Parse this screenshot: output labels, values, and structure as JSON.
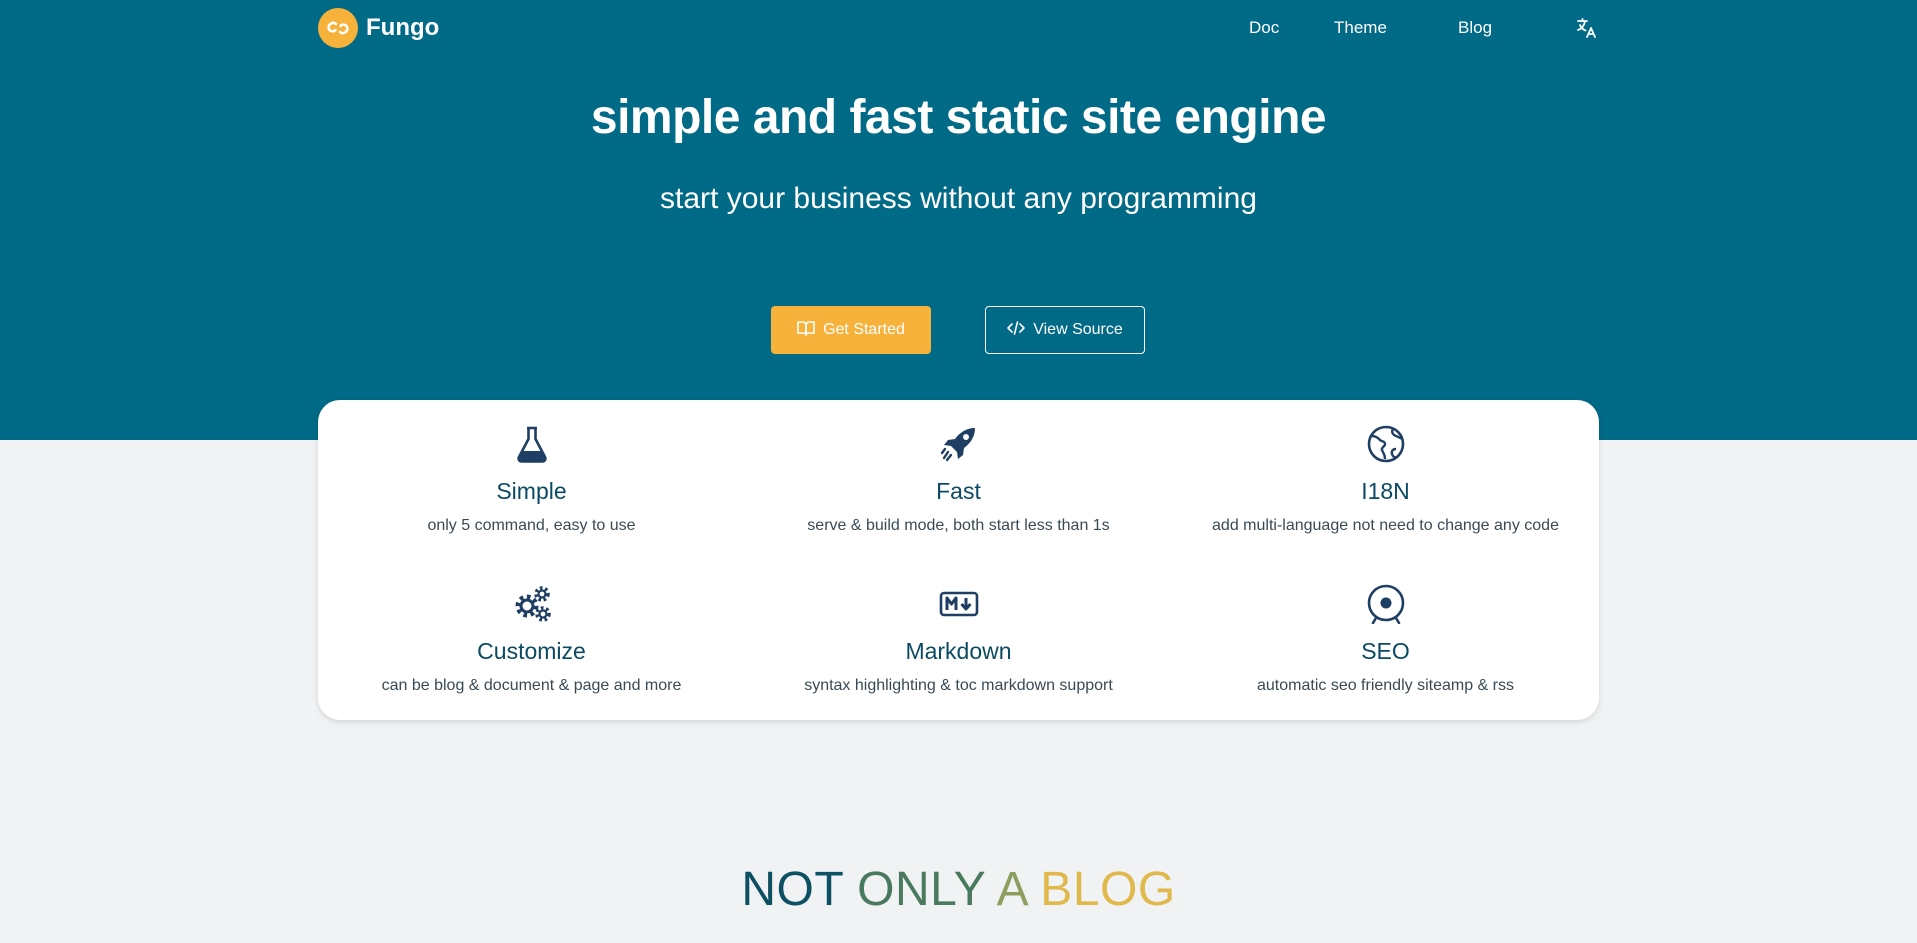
{
  "brand": {
    "name": "Fungo",
    "logo_icon": "link-icon",
    "accent": "#f6b23b"
  },
  "nav": {
    "links": [
      {
        "label": "Doc"
      },
      {
        "label": "Theme"
      },
      {
        "label": "Blog"
      }
    ],
    "language_icon": "translate-icon"
  },
  "hero": {
    "title": "simple and fast static site engine",
    "subtitle": "start your business without any programming",
    "background": "#006a87",
    "primary_button": {
      "label": "Get Started",
      "icon": "book-icon"
    },
    "secondary_button": {
      "label": "View Source",
      "icon": "code-icon"
    }
  },
  "features": [
    {
      "title": "Simple",
      "desc": "only 5 command, easy to use",
      "icon": "flask-icon"
    },
    {
      "title": "Fast",
      "desc": "serve & build mode, both start less than 1s",
      "icon": "rocket-icon"
    },
    {
      "title": "I18N",
      "desc": "add multi-language not need to change any code",
      "icon": "globe-icon"
    },
    {
      "title": "Customize",
      "desc": "can be blog & document & page and more",
      "icon": "gears-icon"
    },
    {
      "title": "Markdown",
      "desc": "syntax highlighting & toc markdown support",
      "icon": "markdown-icon"
    },
    {
      "title": "SEO",
      "desc": "automatic seo friendly siteamp & rss",
      "icon": "target-icon"
    }
  ],
  "section": {
    "words": [
      "NOT",
      "ONLY",
      "A",
      "BLOG"
    ],
    "word_colors": [
      "#0d4f63",
      "#4a7a5e",
      "#8c9f5e",
      "#e0b84c"
    ]
  }
}
